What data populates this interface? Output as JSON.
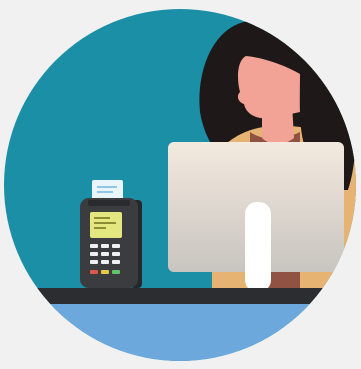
{
  "illustration": {
    "subject": "cashier-with-payment-terminal",
    "palette": {
      "page_background": "#f1f1f1",
      "circle_background": "#1a8fa6",
      "hair": "#1f1818",
      "skin": "#f3a296",
      "shirt": "#e7b373",
      "shirt_shadow": "#8f5243",
      "monitor_face": "#f3eadf",
      "monitor_gradient_end": "#c8c4bf",
      "monitor_stand": "#ffffff",
      "counter_top": "#2b2d31",
      "counter_front": "#6ca8dc",
      "terminal_body": "#3b3c40",
      "terminal_screen": "#e4e67f",
      "receipt_paper": "#e9f5fb"
    },
    "icons": [
      "payment-terminal-icon",
      "receipt-icon",
      "computer-monitor-icon",
      "cashier-person-icon"
    ]
  }
}
